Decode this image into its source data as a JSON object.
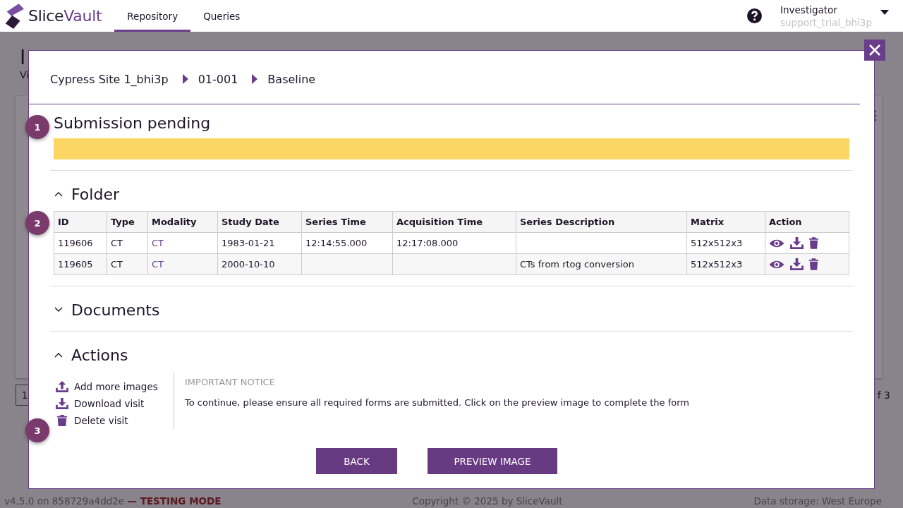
{
  "header": {
    "brand": {
      "first": "Slice",
      "second": "Vault"
    },
    "nav": [
      {
        "label": "Repository",
        "selected": true
      },
      {
        "label": "Queries",
        "selected": false
      }
    ],
    "user": {
      "role": "Investigator",
      "username": "support_trial_bhi3p"
    }
  },
  "background": {
    "title": "I",
    "subtitle": "Vi",
    "page": "1",
    "page_count": "f 3"
  },
  "footer": {
    "version": "v4.5.0 on 858729a4dd2e",
    "mode": "— TESTING MODE",
    "copyright": "Copyright © 2025 by SliceVault",
    "storage": "Data storage: West Europe"
  },
  "modal": {
    "breadcrumb": [
      "Cypress Site 1_bhi3p",
      "01-001",
      "Baseline"
    ],
    "status": {
      "title": "Submission pending",
      "kind": "pending"
    },
    "folder": {
      "title": "Folder",
      "expanded": true,
      "columns": [
        "ID",
        "Type",
        "Modality",
        "Study Date",
        "Series Time",
        "Acquisition Time",
        "Series Description",
        "Matrix",
        "Action"
      ],
      "rows": [
        {
          "id": "119606",
          "type": "CT",
          "modality": "CT",
          "study_date": "1983-01-21",
          "series_time": "12:14:55.000",
          "acquisition_time": "12:17:08.000",
          "description": "",
          "matrix": "512x512x3"
        },
        {
          "id": "119605",
          "type": "CT",
          "modality": "CT",
          "study_date": "2000-10-10",
          "series_time": "",
          "acquisition_time": "",
          "description": "CTs from rtog conversion",
          "matrix": "512x512x3"
        }
      ]
    },
    "documents": {
      "title": "Documents",
      "expanded": false
    },
    "actions": {
      "title": "Actions",
      "expanded": true,
      "items": [
        {
          "label": "Add more images",
          "kind": "upload"
        },
        {
          "label": "Download visit",
          "kind": "download"
        },
        {
          "label": "Delete visit",
          "kind": "delete"
        }
      ],
      "notice": {
        "title": "IMPORTANT NOTICE",
        "text": "To continue, please ensure all required forms are submitted. Click on the preview image to complete the form"
      }
    },
    "buttons": [
      "BACK",
      "PREVIEW IMAGE"
    ]
  },
  "steps": [
    "1",
    "2",
    "3"
  ]
}
